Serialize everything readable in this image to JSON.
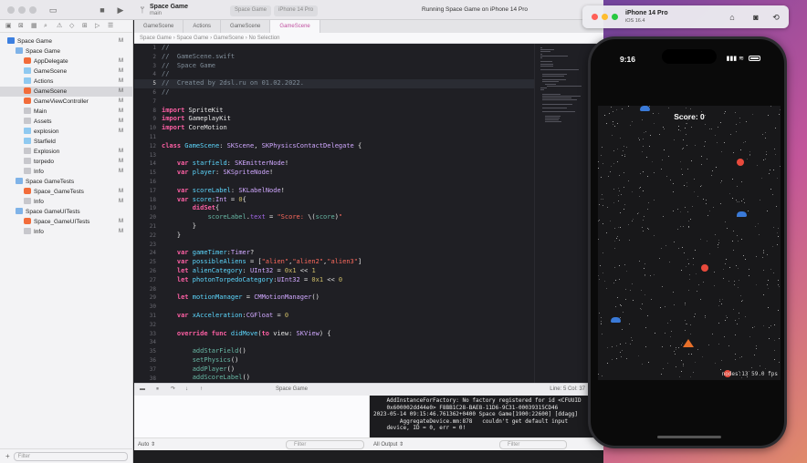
{
  "toolbar": {
    "scheme_title": "Space Game",
    "scheme_branch": "main",
    "breadcrumb": [
      "Space Game",
      "iPhone 14 Pro"
    ],
    "run_status": "Running Space Game on iPhone 14 Pro"
  },
  "navigator": {
    "items": [
      {
        "label": "Space Game",
        "badge": "M",
        "indent": 0,
        "icon": "project-icon"
      },
      {
        "label": "Space Game",
        "badge": "",
        "indent": 1,
        "icon": "folder-icon"
      },
      {
        "label": "AppDelegate",
        "badge": "M",
        "indent": 2,
        "icon": "swift-file-icon"
      },
      {
        "label": "GameScene",
        "badge": "M",
        "indent": 2,
        "icon": "sks-file-icon"
      },
      {
        "label": "Actions",
        "badge": "M",
        "indent": 2,
        "icon": "sks-file-icon"
      },
      {
        "label": "GameScene",
        "badge": "M",
        "indent": 2,
        "icon": "swift-file-icon",
        "selected": true
      },
      {
        "label": "GameViewController",
        "badge": "M",
        "indent": 2,
        "icon": "swift-file-icon"
      },
      {
        "label": "Main",
        "badge": "M",
        "indent": 2,
        "icon": "storyboard-icon"
      },
      {
        "label": "Assets",
        "badge": "M",
        "indent": 2,
        "icon": "assets-icon"
      },
      {
        "label": "explosion",
        "badge": "M",
        "indent": 2,
        "icon": "sks-file-icon"
      },
      {
        "label": "Starfield",
        "badge": "",
        "indent": 2,
        "icon": "sks-file-icon"
      },
      {
        "label": "Explosion",
        "badge": "M",
        "indent": 2,
        "icon": "file-icon"
      },
      {
        "label": "torpedo",
        "badge": "M",
        "indent": 2,
        "icon": "file-icon"
      },
      {
        "label": "Info",
        "badge": "M",
        "indent": 2,
        "icon": "file-icon"
      },
      {
        "label": "Space GameTests",
        "badge": "",
        "indent": 1,
        "icon": "folder-icon"
      },
      {
        "label": "Space_GameTests",
        "badge": "M",
        "indent": 2,
        "icon": "swift-file-icon"
      },
      {
        "label": "Info",
        "badge": "M",
        "indent": 2,
        "icon": "file-icon"
      },
      {
        "label": "Space GameUITests",
        "badge": "",
        "indent": 1,
        "icon": "folder-icon"
      },
      {
        "label": "Space_GameUITests",
        "badge": "M",
        "indent": 2,
        "icon": "swift-file-icon"
      },
      {
        "label": "Info",
        "badge": "M",
        "indent": 2,
        "icon": "file-icon"
      }
    ],
    "filter_placeholder": "Filter"
  },
  "tabs": [
    "GameScene",
    "Actions",
    "GameScene",
    "GameScene"
  ],
  "jumpbar": [
    "Space Game",
    "Space Game",
    "GameScene",
    "No Selection"
  ],
  "editor": {
    "current_line": 5,
    "lines": [
      [
        [
          "c-cm",
          "//"
        ]
      ],
      [
        [
          "c-cm",
          "//  GameScene.swift"
        ]
      ],
      [
        [
          "c-cm",
          "//  Space Game"
        ]
      ],
      [
        [
          "c-cm",
          "//"
        ]
      ],
      [
        [
          "c-cm",
          "//  Created by 2dsl.ru on 01.02.2022."
        ]
      ],
      [
        [
          "c-cm",
          "//"
        ]
      ],
      [],
      [
        [
          "c-kw",
          "import"
        ],
        [
          "",
          " SpriteKit"
        ]
      ],
      [
        [
          "c-kw",
          "import"
        ],
        [
          "",
          " GameplayKit"
        ]
      ],
      [
        [
          "c-kw",
          "import"
        ],
        [
          "",
          " CoreMotion"
        ]
      ],
      [],
      [
        [
          "c-kw",
          "class"
        ],
        [
          "c-ty",
          " GameScene"
        ],
        [
          "",
          ": "
        ],
        [
          "c-ty2",
          "SKScene"
        ],
        [
          "",
          ", "
        ],
        [
          "c-ty2",
          "SKPhysicsContactDelegate"
        ],
        [
          "",
          " {"
        ]
      ],
      [],
      [
        [
          "",
          "    "
        ],
        [
          "c-kw",
          "var"
        ],
        [
          "c-ty",
          " starfield"
        ],
        [
          "",
          ": "
        ],
        [
          "c-ty2",
          "SKEmitterNode"
        ],
        [
          "",
          "!"
        ]
      ],
      [
        [
          "",
          "    "
        ],
        [
          "c-kw",
          "var"
        ],
        [
          "c-ty",
          " player"
        ],
        [
          "",
          ": "
        ],
        [
          "c-ty2",
          "SKSpriteNode"
        ],
        [
          "",
          "!"
        ]
      ],
      [],
      [
        [
          "",
          "    "
        ],
        [
          "c-kw",
          "var"
        ],
        [
          "c-ty",
          " scoreLabel"
        ],
        [
          "",
          ": "
        ],
        [
          "c-ty2",
          "SKLabelNode"
        ],
        [
          "",
          "!"
        ]
      ],
      [
        [
          "",
          "    "
        ],
        [
          "c-kw",
          "var"
        ],
        [
          "c-ty",
          " score"
        ],
        [
          "",
          ":"
        ],
        [
          "c-ty2",
          "Int"
        ],
        [
          "",
          " = "
        ],
        [
          "c-num",
          "0"
        ],
        [
          "",
          "{"
        ]
      ],
      [
        [
          "",
          "        "
        ],
        [
          "c-kw",
          "didSet"
        ],
        [
          "",
          "{"
        ]
      ],
      [
        [
          "",
          "            "
        ],
        [
          "c-fn",
          "scoreLabel"
        ],
        [
          "",
          "."
        ],
        [
          "c-pl",
          "text"
        ],
        [
          "",
          " = "
        ],
        [
          "c-str",
          "\"Score: "
        ],
        [
          "",
          "\\("
        ],
        [
          "c-fn",
          "score"
        ],
        [
          "",
          ")"
        ],
        [
          "c-str",
          "\""
        ]
      ],
      [
        [
          "",
          "        }"
        ]
      ],
      [
        [
          "",
          "    }"
        ]
      ],
      [],
      [
        [
          "",
          "    "
        ],
        [
          "c-kw",
          "var"
        ],
        [
          "c-ty",
          " gameTimer"
        ],
        [
          "",
          ":"
        ],
        [
          "c-ty2",
          "Timer"
        ],
        [
          "",
          "?"
        ]
      ],
      [
        [
          "",
          "    "
        ],
        [
          "c-kw",
          "var"
        ],
        [
          "c-ty",
          " possibleAliens"
        ],
        [
          "",
          " = ["
        ],
        [
          "c-str",
          "\"alien\""
        ],
        [
          "",
          ","
        ],
        [
          "c-str",
          "\"alien2\""
        ],
        [
          "",
          ","
        ],
        [
          "c-str",
          "\"alien3\""
        ],
        [
          "",
          "]"
        ]
      ],
      [
        [
          "",
          "    "
        ],
        [
          "c-kw",
          "let"
        ],
        [
          "c-ty",
          " alienCategory"
        ],
        [
          "",
          ": "
        ],
        [
          "c-ty2",
          "UInt32"
        ],
        [
          "",
          " = "
        ],
        [
          "c-num",
          "0x1"
        ],
        [
          "",
          " << "
        ],
        [
          "c-num",
          "1"
        ]
      ],
      [
        [
          "",
          "    "
        ],
        [
          "c-kw",
          "let"
        ],
        [
          "c-ty",
          " photonTorpedoCategory"
        ],
        [
          "",
          ":"
        ],
        [
          "c-ty2",
          "UInt32"
        ],
        [
          "",
          " = "
        ],
        [
          "c-num",
          "0x1"
        ],
        [
          "",
          " << "
        ],
        [
          "c-num",
          "0"
        ]
      ],
      [],
      [
        [
          "",
          "    "
        ],
        [
          "c-kw",
          "let"
        ],
        [
          "c-ty",
          " motionManager"
        ],
        [
          "",
          " = "
        ],
        [
          "c-ty2",
          "CMMotionManager"
        ],
        [
          "",
          "()"
        ]
      ],
      [],
      [
        [
          "",
          "    "
        ],
        [
          "c-kw",
          "var"
        ],
        [
          "c-ty",
          " xAcceleration"
        ],
        [
          "",
          ":"
        ],
        [
          "c-ty2",
          "CGFloat"
        ],
        [
          "",
          " = "
        ],
        [
          "c-num",
          "0"
        ]
      ],
      [],
      [
        [
          "",
          "    "
        ],
        [
          "c-kw",
          "override func"
        ],
        [
          "c-ty",
          " didMove"
        ],
        [
          "",
          "("
        ],
        [
          "c-kw",
          "to"
        ],
        [
          "",
          " view: "
        ],
        [
          "c-ty2",
          "SKView"
        ],
        [
          "",
          ") {"
        ]
      ],
      [],
      [
        [
          "",
          "        "
        ],
        [
          "c-fn",
          "addStarField"
        ],
        [
          "",
          "()"
        ]
      ],
      [
        [
          "",
          "        "
        ],
        [
          "c-fn",
          "setPhysics"
        ],
        [
          "",
          "()"
        ]
      ],
      [
        [
          "",
          "        "
        ],
        [
          "c-fn",
          "addPlayer"
        ],
        [
          "",
          "()"
        ]
      ],
      [
        [
          "",
          "        "
        ],
        [
          "c-fn",
          "addScoreLabel"
        ],
        [
          "",
          "()"
        ]
      ]
    ]
  },
  "statusbar": {
    "breadcrumb": "Space Game",
    "position": "Line: 5  Col: 37"
  },
  "console": {
    "lines": [
      "    AddInstanceForFactory: No factory registered for id <CFUUID",
      "    0x600002dd44e0> F8BB1C28-BAE8-11D6-9C31-00039315CD46",
      "2023-05-14 09:15:46.761362+0400 Space Game[1900:22600] [ddagg]",
      "        AggregateDevice.mm:878   couldn't get default input",
      "    device, ID = 0, err = 0!"
    ]
  },
  "debug_footer": {
    "auto_label": "Auto ⇕",
    "variables_filter_placeholder": "Filter",
    "output_label": "All Output ⇕",
    "console_filter_placeholder": "Filter"
  },
  "simulator": {
    "title": "iPhone 14 Pro",
    "subtitle": "iOS 16.4",
    "time": "9:16",
    "score_text": "Score: 0",
    "fps_text": "nodes:13  59.0 fps"
  },
  "colors": {
    "keyword": "#fc5fa3",
    "type": "#5dd8ff",
    "string": "#fc6a5d",
    "comment": "#7f8c98",
    "alien_red": "#e84a3c",
    "alien_blue": "#3a7ad8"
  }
}
